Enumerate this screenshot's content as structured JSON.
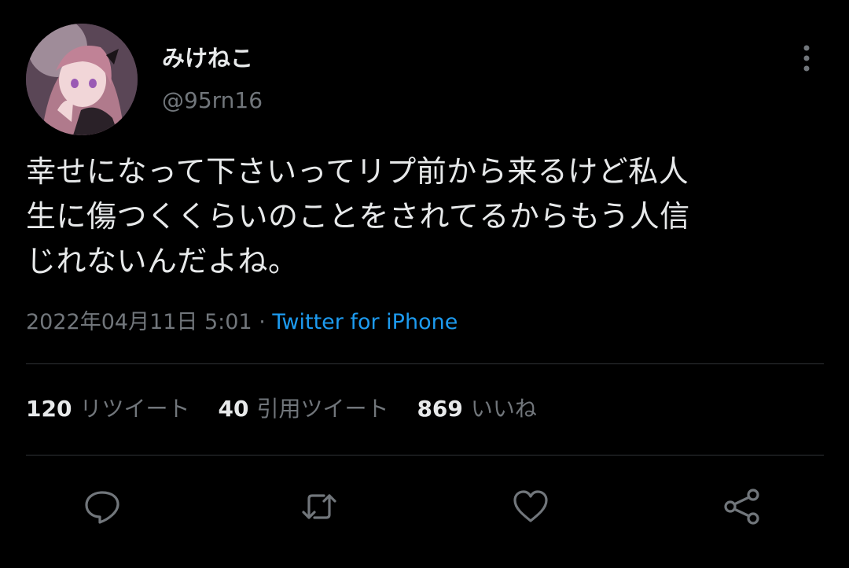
{
  "colors": {
    "background": "#000000",
    "text_primary": "#e7e9ea",
    "text_secondary": "#71767b",
    "link": "#1d9bf0",
    "divider": "#2f3336"
  },
  "author": {
    "display_name": "みけねこ",
    "handle": "@95rn16",
    "avatar_icon": "profile-avatar-anime-girl"
  },
  "tweet": {
    "lines": [
      "幸せになって下さいってリプ前から来るけど私人",
      "生に傷つくくらいのことをされてるからもう人信",
      "じれないんだよね。"
    ]
  },
  "meta": {
    "timestamp": "2022年04月11日 5:01",
    "separator": " · ",
    "source": "Twitter for iPhone"
  },
  "stats": [
    {
      "count": "120",
      "label": "リツイート"
    },
    {
      "count": "40",
      "label": "引用ツイート"
    },
    {
      "count": "869",
      "label": "いいね"
    }
  ],
  "actions": [
    {
      "icon": "reply-icon"
    },
    {
      "icon": "retweet-icon"
    },
    {
      "icon": "like-icon"
    },
    {
      "icon": "share-icon"
    }
  ]
}
